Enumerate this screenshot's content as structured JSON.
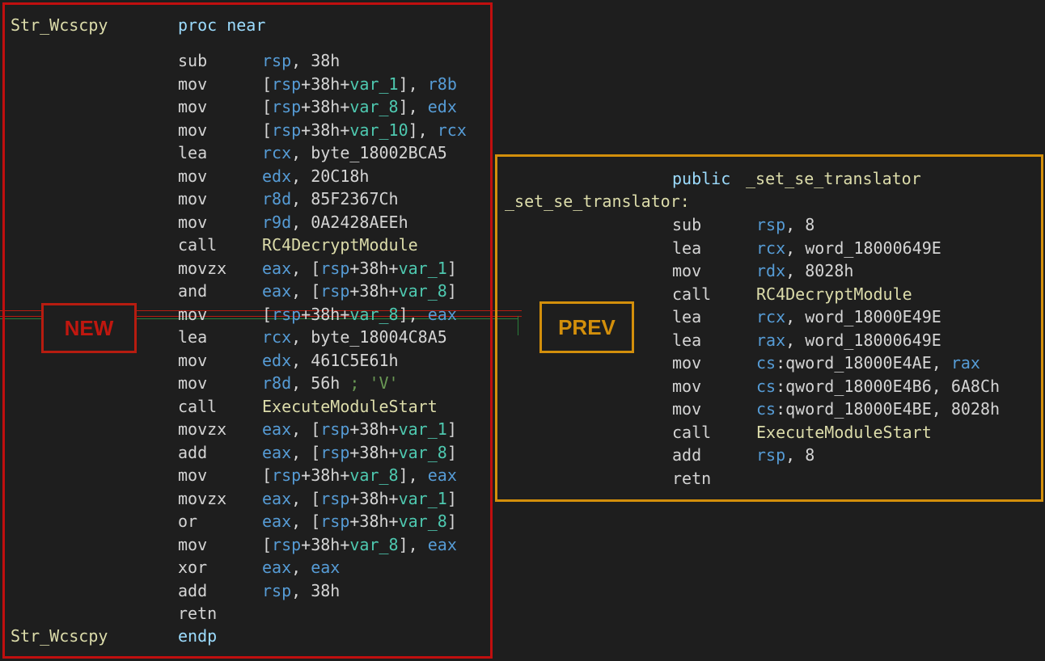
{
  "new_panel": {
    "tag": "NEW",
    "func_name": "Str_Wcscpy",
    "proc_kw": "proc near",
    "endp_kw": "endp",
    "lines": [
      {
        "m": "sub",
        "ops": [
          [
            "reg",
            "rsp"
          ],
          [
            "num",
            ", 38h"
          ]
        ]
      },
      {
        "m": "mov",
        "ops": [
          [
            "num",
            "["
          ],
          [
            "reg",
            "rsp"
          ],
          [
            "num",
            "+38h+"
          ],
          [
            "var",
            "var_1"
          ],
          [
            "num",
            "], "
          ],
          [
            "reg",
            "r8b"
          ]
        ]
      },
      {
        "m": "mov",
        "ops": [
          [
            "num",
            "["
          ],
          [
            "reg",
            "rsp"
          ],
          [
            "num",
            "+38h+"
          ],
          [
            "var",
            "var_8"
          ],
          [
            "num",
            "], "
          ],
          [
            "reg",
            "edx"
          ]
        ]
      },
      {
        "m": "mov",
        "ops": [
          [
            "num",
            "["
          ],
          [
            "reg",
            "rsp"
          ],
          [
            "num",
            "+38h+"
          ],
          [
            "var",
            "var_10"
          ],
          [
            "num",
            "], "
          ],
          [
            "reg",
            "rcx"
          ]
        ]
      },
      {
        "m": "lea",
        "ops": [
          [
            "reg",
            "rcx"
          ],
          [
            "num",
            ", byte_18002BCA5"
          ]
        ]
      },
      {
        "m": "mov",
        "ops": [
          [
            "reg",
            "edx"
          ],
          [
            "num",
            ", 20C18h"
          ]
        ]
      },
      {
        "m": "mov",
        "ops": [
          [
            "reg",
            "r8d"
          ],
          [
            "num",
            ", 85F2367Ch"
          ]
        ]
      },
      {
        "m": "mov",
        "ops": [
          [
            "reg",
            "r9d"
          ],
          [
            "num",
            ", 0A2428AEEh"
          ]
        ]
      },
      {
        "m": "call",
        "ops": [
          [
            "fn",
            "RC4DecryptModule"
          ]
        ]
      },
      {
        "m": "movzx",
        "ops": [
          [
            "reg",
            "eax"
          ],
          [
            "num",
            ", ["
          ],
          [
            "reg",
            "rsp"
          ],
          [
            "num",
            "+38h+"
          ],
          [
            "var",
            "var_1"
          ],
          [
            "num",
            "]"
          ]
        ]
      },
      {
        "m": "and",
        "ops": [
          [
            "reg",
            "eax"
          ],
          [
            "num",
            ", ["
          ],
          [
            "reg",
            "rsp"
          ],
          [
            "num",
            "+38h+"
          ],
          [
            "var",
            "var_8"
          ],
          [
            "num",
            "]"
          ]
        ]
      },
      {
        "m": "mov",
        "ops": [
          [
            "num",
            "["
          ],
          [
            "reg",
            "rsp"
          ],
          [
            "num",
            "+38h+"
          ],
          [
            "var",
            "var_8"
          ],
          [
            "num",
            "], "
          ],
          [
            "reg",
            "eax"
          ]
        ]
      },
      {
        "m": "lea",
        "ops": [
          [
            "reg",
            "rcx"
          ],
          [
            "num",
            ", byte_18004C8A5"
          ]
        ]
      },
      {
        "m": "mov",
        "ops": [
          [
            "reg",
            "edx"
          ],
          [
            "num",
            ", 461C5E61h"
          ]
        ]
      },
      {
        "m": "mov",
        "ops": [
          [
            "reg",
            "r8d"
          ],
          [
            "num",
            ", 56h "
          ],
          [
            "cmt",
            "; 'V'"
          ]
        ]
      },
      {
        "m": "call",
        "ops": [
          [
            "fn",
            "ExecuteModuleStart"
          ]
        ]
      },
      {
        "m": "movzx",
        "ops": [
          [
            "reg",
            "eax"
          ],
          [
            "num",
            ", ["
          ],
          [
            "reg",
            "rsp"
          ],
          [
            "num",
            "+38h+"
          ],
          [
            "var",
            "var_1"
          ],
          [
            "num",
            "]"
          ]
        ]
      },
      {
        "m": "add",
        "ops": [
          [
            "reg",
            "eax"
          ],
          [
            "num",
            ", ["
          ],
          [
            "reg",
            "rsp"
          ],
          [
            "num",
            "+38h+"
          ],
          [
            "var",
            "var_8"
          ],
          [
            "num",
            "]"
          ]
        ]
      },
      {
        "m": "mov",
        "ops": [
          [
            "num",
            "["
          ],
          [
            "reg",
            "rsp"
          ],
          [
            "num",
            "+38h+"
          ],
          [
            "var",
            "var_8"
          ],
          [
            "num",
            "], "
          ],
          [
            "reg",
            "eax"
          ]
        ]
      },
      {
        "m": "movzx",
        "ops": [
          [
            "reg",
            "eax"
          ],
          [
            "num",
            ", ["
          ],
          [
            "reg",
            "rsp"
          ],
          [
            "num",
            "+38h+"
          ],
          [
            "var",
            "var_1"
          ],
          [
            "num",
            "]"
          ]
        ]
      },
      {
        "m": "or",
        "ops": [
          [
            "reg",
            "eax"
          ],
          [
            "num",
            ", ["
          ],
          [
            "reg",
            "rsp"
          ],
          [
            "num",
            "+38h+"
          ],
          [
            "var",
            "var_8"
          ],
          [
            "num",
            "]"
          ]
        ]
      },
      {
        "m": "mov",
        "ops": [
          [
            "num",
            "["
          ],
          [
            "reg",
            "rsp"
          ],
          [
            "num",
            "+38h+"
          ],
          [
            "var",
            "var_8"
          ],
          [
            "num",
            "], "
          ],
          [
            "reg",
            "eax"
          ]
        ]
      },
      {
        "m": "xor",
        "ops": [
          [
            "reg",
            "eax"
          ],
          [
            "num",
            ", "
          ],
          [
            "reg",
            "eax"
          ]
        ]
      },
      {
        "m": "add",
        "ops": [
          [
            "reg",
            "rsp"
          ],
          [
            "num",
            ", 38h"
          ]
        ]
      },
      {
        "m": "retn",
        "ops": []
      }
    ]
  },
  "prev_panel": {
    "tag": "PREV",
    "public_kw": "public",
    "func_name": "_set_se_translator",
    "label": "_set_se_translator:",
    "lines": [
      {
        "m": "sub",
        "ops": [
          [
            "reg",
            "rsp"
          ],
          [
            "num",
            ", 8"
          ]
        ]
      },
      {
        "m": "lea",
        "ops": [
          [
            "reg",
            "rcx"
          ],
          [
            "num",
            ", word_18000649E"
          ]
        ]
      },
      {
        "m": "mov",
        "ops": [
          [
            "reg",
            "rdx"
          ],
          [
            "num",
            ", 8028h"
          ]
        ]
      },
      {
        "m": "call",
        "ops": [
          [
            "fn",
            "RC4DecryptModule"
          ]
        ]
      },
      {
        "m": "lea",
        "ops": [
          [
            "reg",
            "rcx"
          ],
          [
            "num",
            ", word_18000E49E"
          ]
        ]
      },
      {
        "m": "lea",
        "ops": [
          [
            "reg",
            "rax"
          ],
          [
            "num",
            ", word_18000649E"
          ]
        ]
      },
      {
        "m": "mov",
        "ops": [
          [
            "reg",
            "cs"
          ],
          [
            "num",
            ":qword_18000E4AE, "
          ],
          [
            "reg",
            "rax"
          ]
        ]
      },
      {
        "m": "mov",
        "ops": [
          [
            "reg",
            "cs"
          ],
          [
            "num",
            ":qword_18000E4B6, 6A8Ch"
          ]
        ]
      },
      {
        "m": "mov",
        "ops": [
          [
            "reg",
            "cs"
          ],
          [
            "num",
            ":qword_18000E4BE, 8028h"
          ]
        ]
      },
      {
        "m": "call",
        "ops": [
          [
            "fn",
            "ExecuteModuleStart"
          ]
        ]
      },
      {
        "m": "add",
        "ops": [
          [
            "reg",
            "rsp"
          ],
          [
            "num",
            ", 8"
          ]
        ]
      },
      {
        "m": "retn",
        "ops": []
      }
    ]
  }
}
